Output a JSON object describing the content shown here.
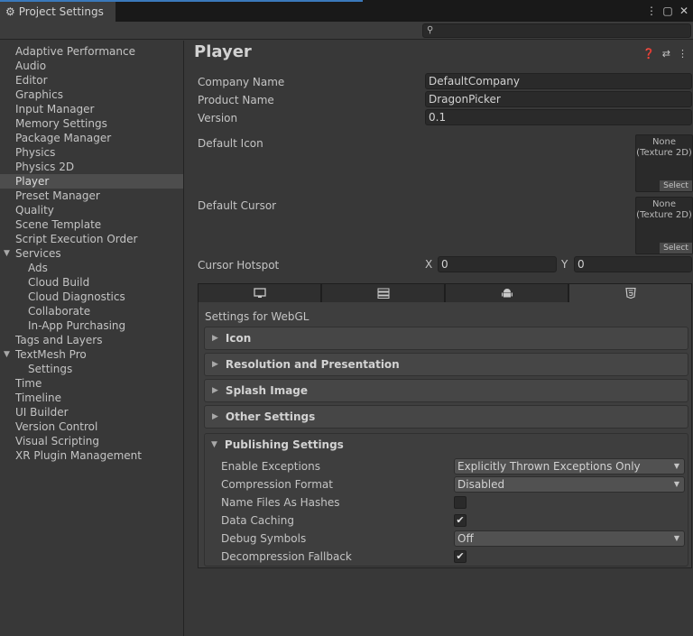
{
  "window": {
    "tab_title": "Project Settings",
    "icons": [
      "gear-icon",
      "kebab-menu-icon",
      "maximize-icon",
      "close-icon"
    ]
  },
  "search": {
    "placeholder": "",
    "icon": "search-icon"
  },
  "sidebar": {
    "items": [
      {
        "label": "Adaptive Performance"
      },
      {
        "label": "Audio"
      },
      {
        "label": "Editor"
      },
      {
        "label": "Graphics"
      },
      {
        "label": "Input Manager"
      },
      {
        "label": "Memory Settings"
      },
      {
        "label": "Package Manager"
      },
      {
        "label": "Physics"
      },
      {
        "label": "Physics 2D"
      },
      {
        "label": "Player",
        "selected": true
      },
      {
        "label": "Preset Manager"
      },
      {
        "label": "Quality"
      },
      {
        "label": "Scene Template"
      },
      {
        "label": "Script Execution Order"
      },
      {
        "label": "Services",
        "expanded": true
      },
      {
        "label": "Ads",
        "child": true
      },
      {
        "label": "Cloud Build",
        "child": true
      },
      {
        "label": "Cloud Diagnostics",
        "child": true
      },
      {
        "label": "Collaborate",
        "child": true
      },
      {
        "label": "In-App Purchasing",
        "child": true
      },
      {
        "label": "Tags and Layers"
      },
      {
        "label": "TextMesh Pro",
        "expanded": true
      },
      {
        "label": "Settings",
        "child": true
      },
      {
        "label": "Time"
      },
      {
        "label": "Timeline"
      },
      {
        "label": "UI Builder"
      },
      {
        "label": "Version Control"
      },
      {
        "label": "Visual Scripting"
      },
      {
        "label": "XR Plugin Management"
      }
    ]
  },
  "main": {
    "title": "Player",
    "header_icons": [
      "help-icon",
      "presets-icon",
      "kebab-menu-icon"
    ],
    "company_name_label": "Company Name",
    "company_name": "DefaultCompany",
    "product_name_label": "Product Name",
    "product_name": "DragonPicker",
    "version_label": "Version",
    "version": "0.1",
    "default_icon_label": "Default Icon",
    "default_icon_value": "None\n(Texture 2D)",
    "default_cursor_label": "Default Cursor",
    "default_cursor_value": "None\n(Texture 2D)",
    "select_label": "Select",
    "cursor_hotspot_label": "Cursor Hotspot",
    "hotspot_x_label": "X",
    "hotspot_x": "0",
    "hotspot_y_label": "Y",
    "hotspot_y": "0",
    "platform_tabs": [
      {
        "icon": "monitor-icon",
        "active": false
      },
      {
        "icon": "server-icon",
        "active": false
      },
      {
        "icon": "android-icon",
        "active": false
      },
      {
        "icon": "html5-icon",
        "active": true
      }
    ],
    "settings_for": "Settings for WebGL",
    "sections": [
      {
        "label": "Icon"
      },
      {
        "label": "Resolution and Presentation"
      },
      {
        "label": "Splash Image"
      },
      {
        "label": "Other Settings"
      },
      {
        "label": "Publishing Settings",
        "expanded": true
      }
    ],
    "publishing": {
      "enable_exceptions_label": "Enable Exceptions",
      "enable_exceptions": "Explicitly Thrown Exceptions Only",
      "compression_format_label": "Compression Format",
      "compression_format": "Disabled",
      "name_files_as_hashes_label": "Name Files As Hashes",
      "name_files_as_hashes": false,
      "data_caching_label": "Data Caching",
      "data_caching": true,
      "debug_symbols_label": "Debug Symbols",
      "debug_symbols": "Off",
      "decompression_fallback_label": "Decompression Fallback",
      "decompression_fallback": true
    }
  }
}
